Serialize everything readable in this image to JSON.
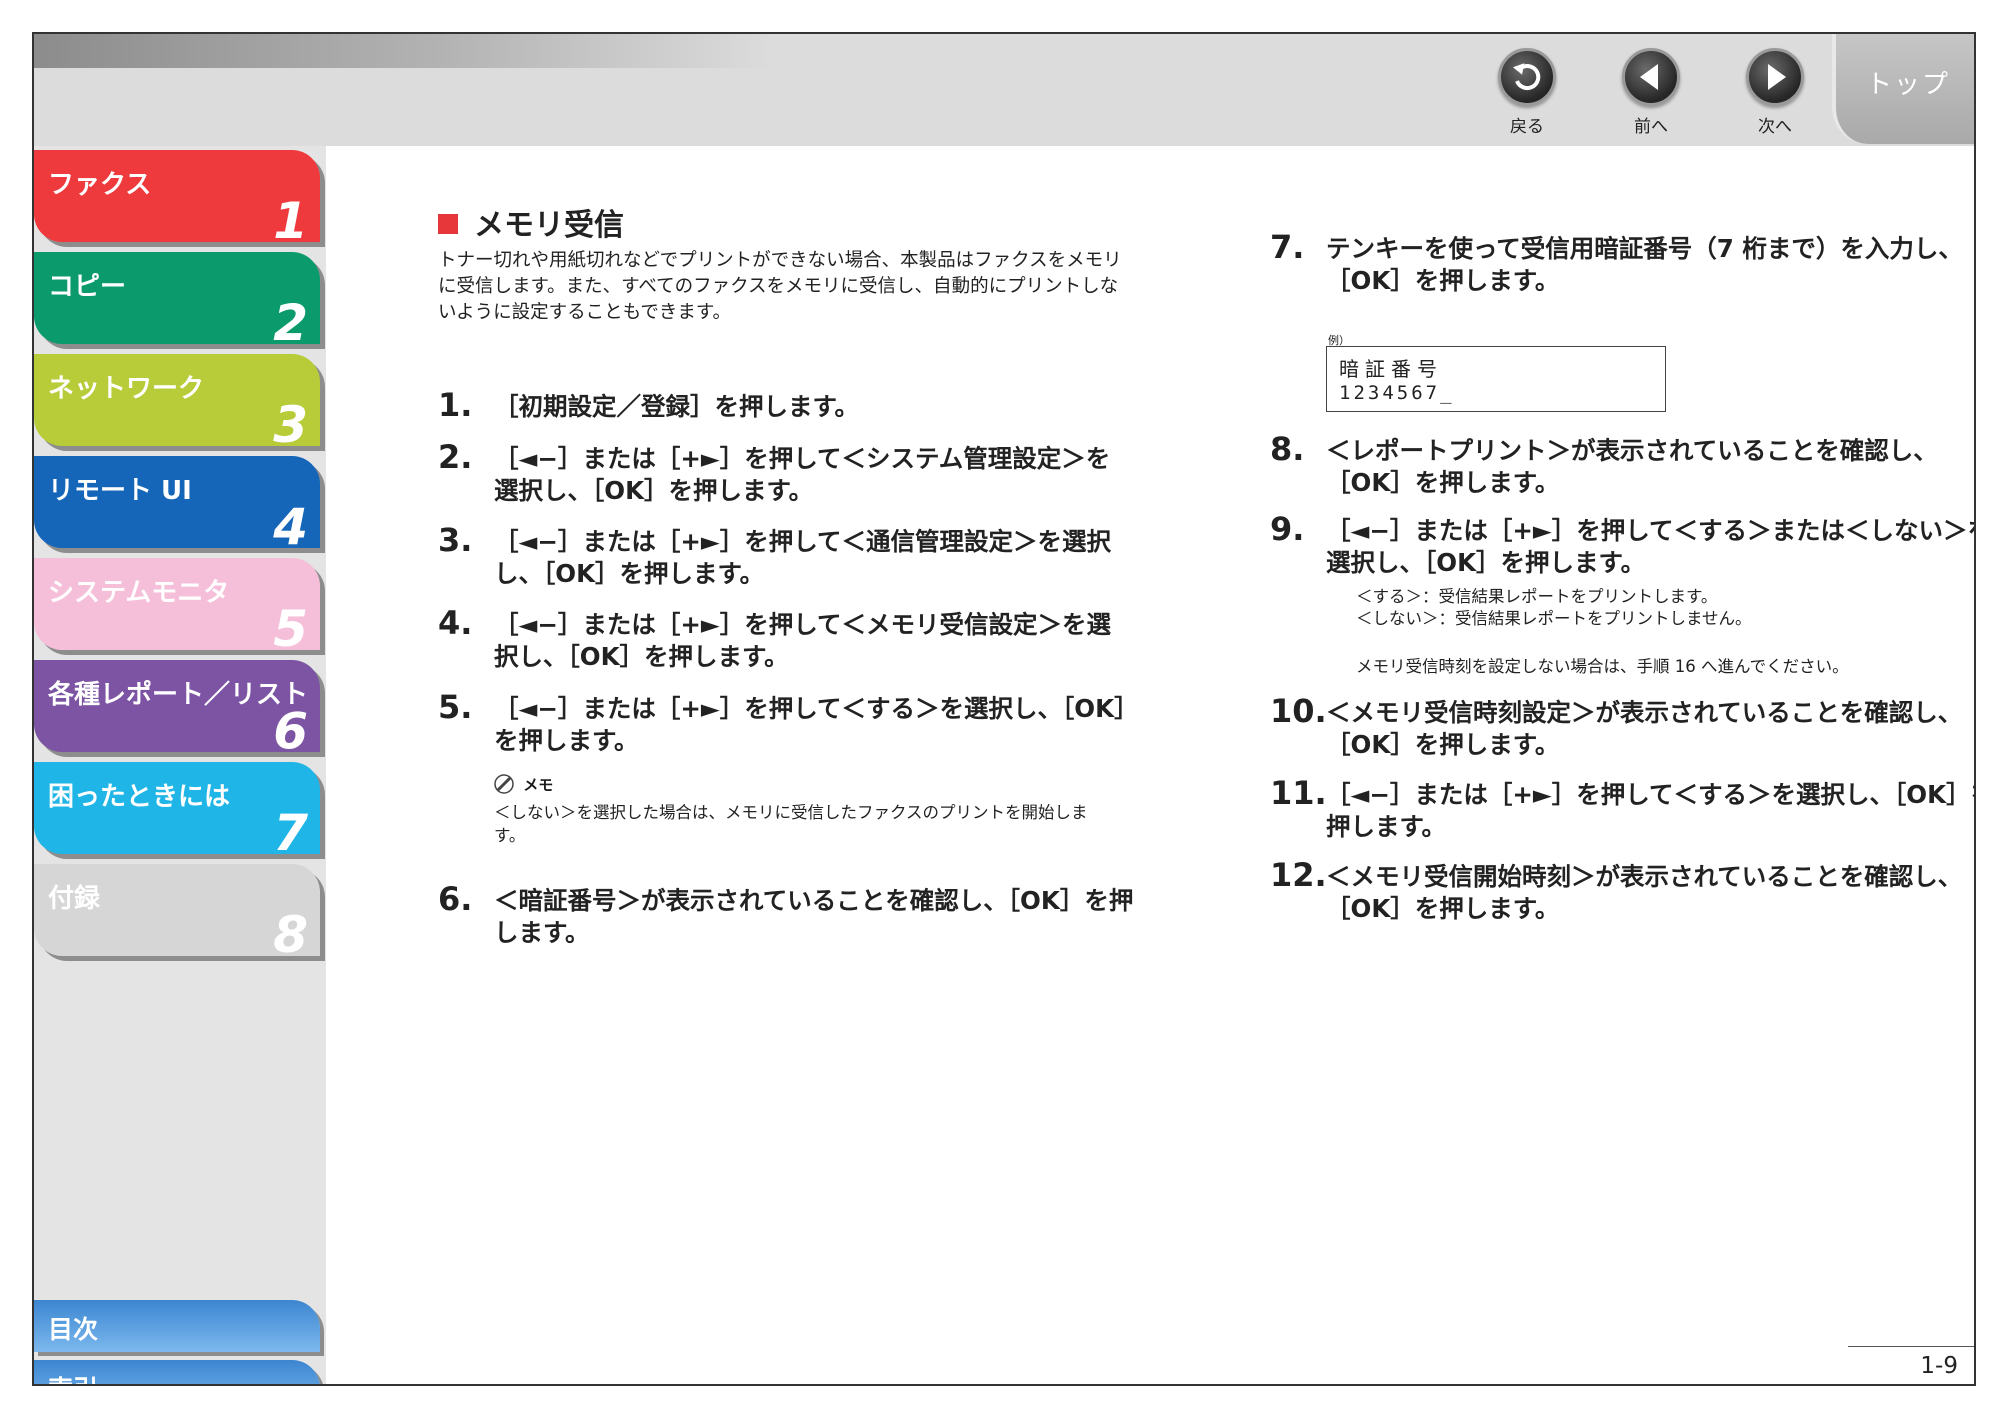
{
  "header": {
    "nav_back": "戻る",
    "nav_prev": "前へ",
    "nav_next": "次へ",
    "top_tab": "トップ"
  },
  "sidebar": {
    "chapters": [
      {
        "label": "ファクス",
        "number": "1",
        "color": "#ee3a3d"
      },
      {
        "label": "コピー",
        "number": "2",
        "color": "#0a9a6b"
      },
      {
        "label": "ネットワーク",
        "number": "3",
        "color": "#b8cc39"
      },
      {
        "label": "リモート UI",
        "number": "4",
        "color": "#1565b8"
      },
      {
        "label": "システムモニタ",
        "number": "5",
        "color": "#f6bfd9"
      },
      {
        "label": "各種レポート／リスト",
        "number": "6",
        "color": "#7c54a3"
      },
      {
        "label": "困ったときには",
        "number": "7",
        "color": "#1fb5e6"
      },
      {
        "label": "付録",
        "number": "8",
        "color": "#d6d6d6"
      }
    ],
    "toc": "目次",
    "index": "索引"
  },
  "content": {
    "title": "メモリ受信",
    "intro": "トナー切れや用紙切れなどでプリントができない場合、本製品はファクスをメモリに受信します。また、すべてのファクスをメモリに受信し、自動的にプリントしないように設定することもできます。",
    "steps": [
      {
        "num": "1.",
        "text": "［初期設定／登録］を押します。"
      },
      {
        "num": "2.",
        "text": "［◄−］または［+►］を押して＜システム管理設定＞を選択し、［OK］を押します。"
      },
      {
        "num": "3.",
        "text": "［◄−］または［+►］を押して＜通信管理設定＞を選択し、［OK］を押します。"
      },
      {
        "num": "4.",
        "text": "［◄−］または［+►］を押して＜メモリ受信設定＞を選択し、［OK］を押します。"
      },
      {
        "num": "5.",
        "text": "［◄−］または［+►］を押して＜する＞を選択し、［OK］を押します。"
      },
      {
        "num": "6.",
        "text": "＜暗証番号＞が表示されていることを確認し、［OK］を押します。"
      },
      {
        "num": "7.",
        "text": "テンキーを使って受信用暗証番号（7 桁まで）を入力し、［OK］を押します。"
      },
      {
        "num": "8.",
        "text": "＜レポートプリント＞が表示されていることを確認し、［OK］を押します。"
      },
      {
        "num": "9.",
        "text": "［◄−］または［+►］を押して＜する＞または＜しない＞を選択し、［OK］を押します。"
      },
      {
        "num": "10.",
        "text": "＜メモリ受信時刻設定＞が表示されていることを確認し、［OK］を押します。"
      },
      {
        "num": "11.",
        "text": "［◄−］または［+►］を押して＜する＞を選択し、［OK］を押します。"
      },
      {
        "num": "12.",
        "text": "＜メモリ受信開始時刻＞が表示されていることを確認し、［OK］を押します。"
      }
    ],
    "memo": {
      "heading": "メモ",
      "text": "＜しない＞を選択した場合は、メモリに受信したファクスのプリントを開始します。"
    },
    "example": {
      "label": "例）",
      "line1": "暗証番号",
      "line2": "1234567_"
    },
    "step9_options": [
      "＜する＞：受信結果レポートをプリントします。",
      "＜しない＞：受信結果レポートをプリントしません。"
    ],
    "step9_note": "メモリ受信時刻を設定しない場合は、手順 16 へ進んでください。"
  },
  "footer": {
    "page": "1-9"
  }
}
